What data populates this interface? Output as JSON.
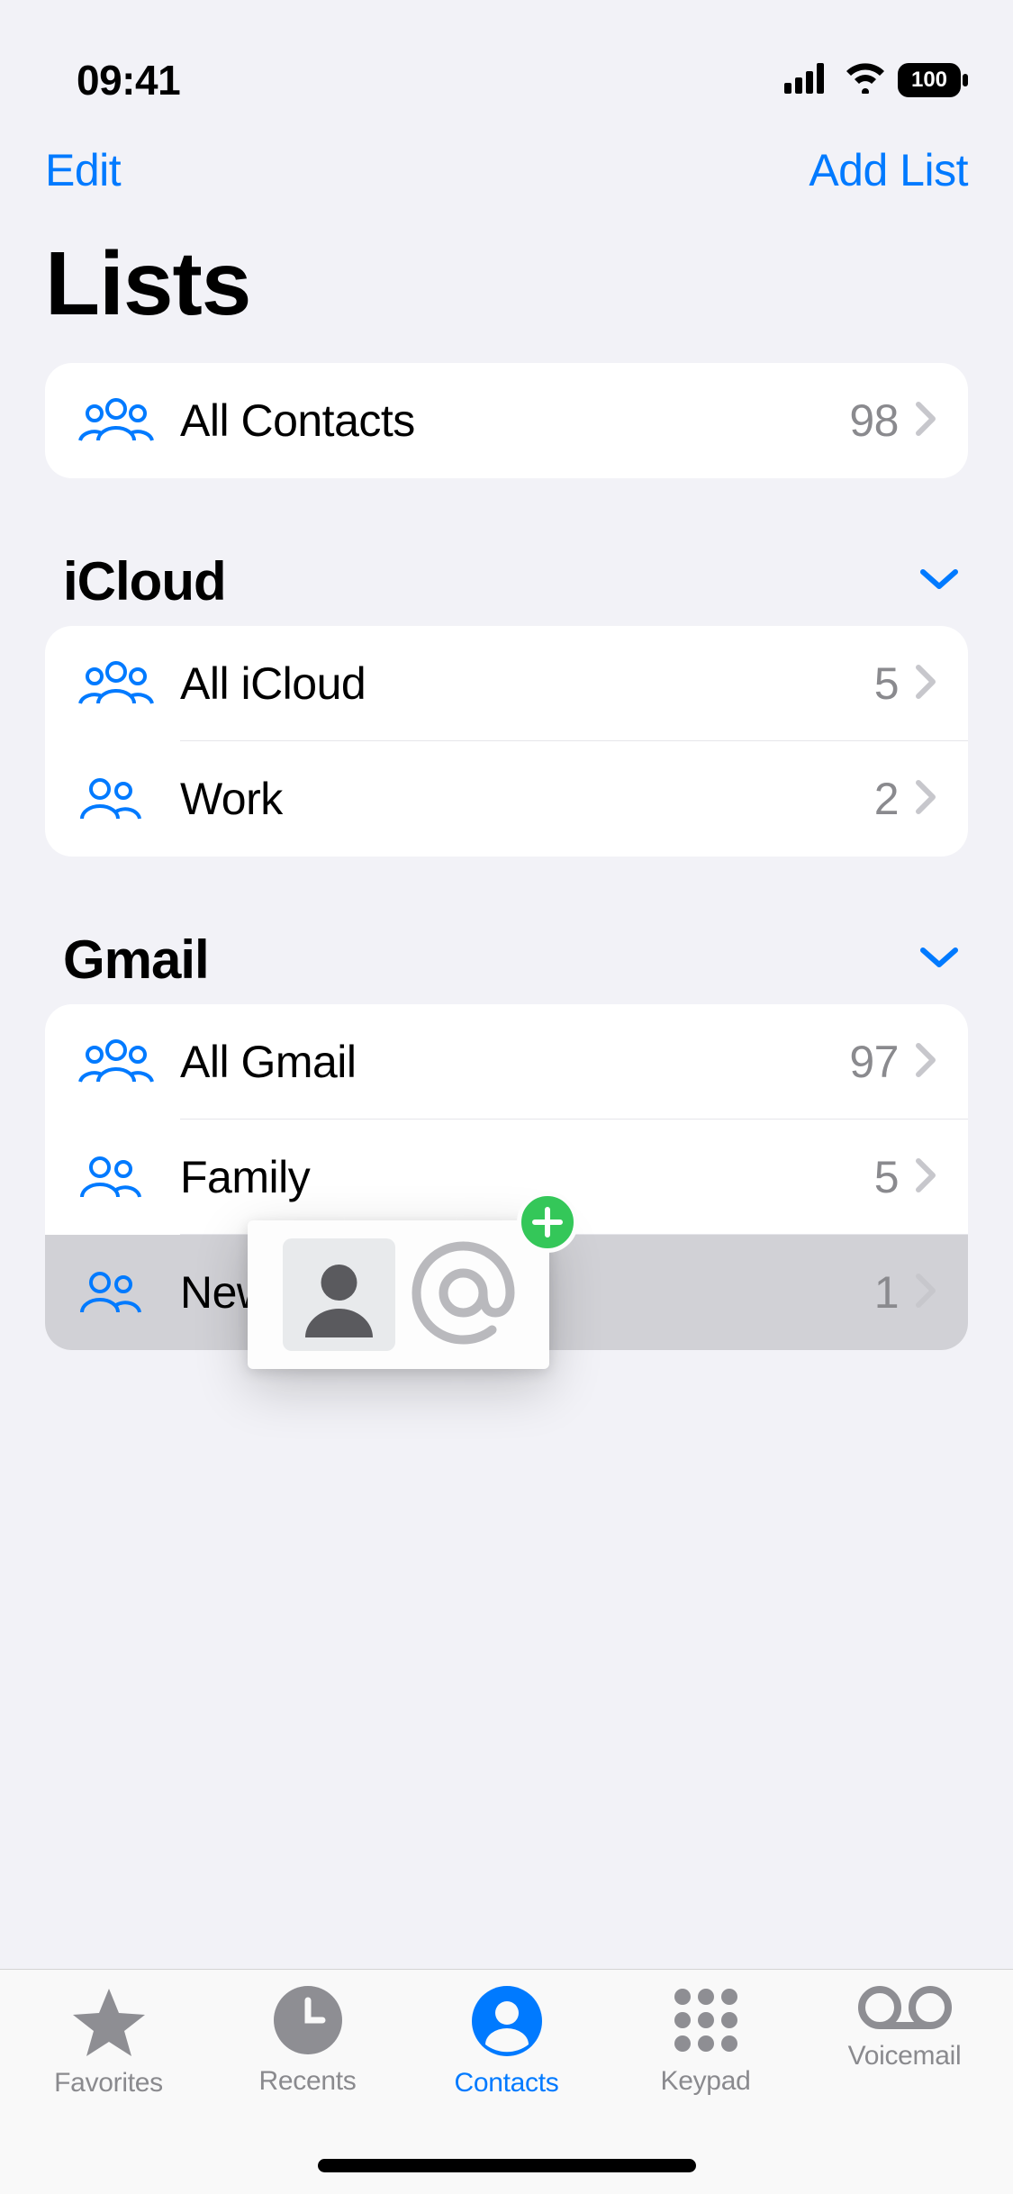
{
  "status": {
    "time": "09:41",
    "battery": "100"
  },
  "nav": {
    "edit": "Edit",
    "add_list": "Add List"
  },
  "title": "Lists",
  "all_contacts": {
    "label": "All Contacts",
    "count": "98"
  },
  "sections": [
    {
      "title": "iCloud",
      "items": [
        {
          "icon": "three",
          "label": "All iCloud",
          "count": "5"
        },
        {
          "icon": "two",
          "label": "Work",
          "count": "2"
        }
      ]
    },
    {
      "title": "Gmail",
      "items": [
        {
          "icon": "three",
          "label": "All Gmail",
          "count": "97"
        },
        {
          "icon": "two",
          "label": "Family",
          "count": "5"
        },
        {
          "icon": "two",
          "label": "New",
          "count": "1",
          "highlight": true
        }
      ]
    }
  ],
  "tabs": {
    "favorites": "Favorites",
    "recents": "Recents",
    "contacts": "Contacts",
    "keypad": "Keypad",
    "voicemail": "Voicemail"
  }
}
